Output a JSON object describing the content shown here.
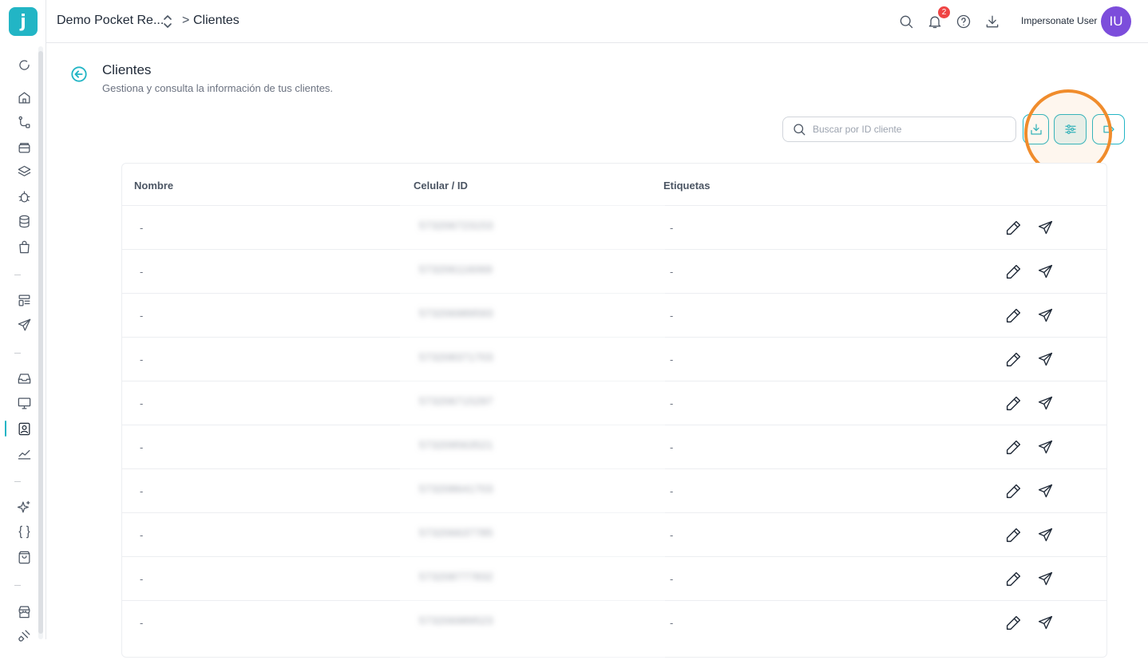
{
  "app": {
    "logo_letter": "j",
    "workspace": "Demo Pocket Re...",
    "breadcrumb_separator": ">",
    "breadcrumb_current": "Clientes"
  },
  "sidebar": {
    "items": [
      {
        "icon": "refresh-icon",
        "top": 0
      },
      {
        "icon": "home-icon"
      },
      {
        "icon": "flow-icon"
      },
      {
        "icon": "archive-icon"
      },
      {
        "icon": "layers-icon"
      },
      {
        "icon": "bug-icon"
      },
      {
        "icon": "database-icon"
      },
      {
        "icon": "shopping-bag-icon"
      },
      {
        "icon": "layout-list-icon"
      },
      {
        "icon": "send-icon"
      },
      {
        "icon": "inbox-icon"
      },
      {
        "icon": "monitor-icon"
      },
      {
        "icon": "contacts-icon",
        "active": true
      },
      {
        "icon": "chart-line-icon"
      },
      {
        "icon": "sparkles-icon"
      },
      {
        "icon": "braces-icon"
      },
      {
        "icon": "shopping-basket-icon"
      },
      {
        "icon": "store-icon"
      },
      {
        "icon": "plug-icon"
      }
    ],
    "accent_color": "#22b5c5"
  },
  "header": {
    "notifications_count": "2",
    "user_name": "Impersonate User",
    "avatar_initials": "IU",
    "avatar_color": "#7c4ddb"
  },
  "page": {
    "title": "Clientes",
    "subtitle": "Gestiona y consulta la información de tus clientes."
  },
  "toolbar": {
    "search_placeholder": "Buscar por ID cliente",
    "buttons": [
      "download-icon",
      "filter-sliders-icon",
      "tag-icon"
    ]
  },
  "table": {
    "columns": [
      "Nombre",
      "Celular / ID",
      "Etiquetas"
    ],
    "rows": [
      {
        "nombre": "-",
        "celular": "573206723153",
        "etiquetas": "-"
      },
      {
        "nombre": "-",
        "celular": "573206116069",
        "etiquetas": "-"
      },
      {
        "nombre": "-",
        "celular": "573206989593",
        "etiquetas": "-"
      },
      {
        "nombre": "-",
        "celular": "573208371703",
        "etiquetas": "-"
      },
      {
        "nombre": "-",
        "celular": "573206715297",
        "etiquetas": "-"
      },
      {
        "nombre": "-",
        "celular": "573209563521",
        "etiquetas": "-"
      },
      {
        "nombre": "-",
        "celular": "573208641703",
        "etiquetas": "-"
      },
      {
        "nombre": "-",
        "celular": "573206637785",
        "etiquetas": "-"
      },
      {
        "nombre": "-",
        "celular": "573208777832",
        "etiquetas": "-"
      },
      {
        "nombre": "-",
        "celular": "573206989523",
        "etiquetas": "-"
      }
    ]
  }
}
